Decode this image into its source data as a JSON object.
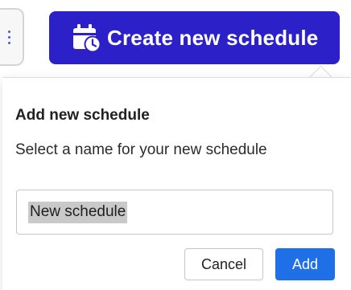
{
  "toolbar": {
    "more_icon": "more-vertical-icon",
    "create_button": {
      "label": "Create new schedule",
      "icon": "calendar-clock-icon",
      "color": "#2c20c8"
    }
  },
  "dialog": {
    "title": "Add new schedule",
    "description": "Select a name for your new schedule",
    "name_input": {
      "value": "New schedule"
    },
    "cancel_label": "Cancel",
    "add_label": "Add",
    "accent_color": "#1f6fe6"
  }
}
